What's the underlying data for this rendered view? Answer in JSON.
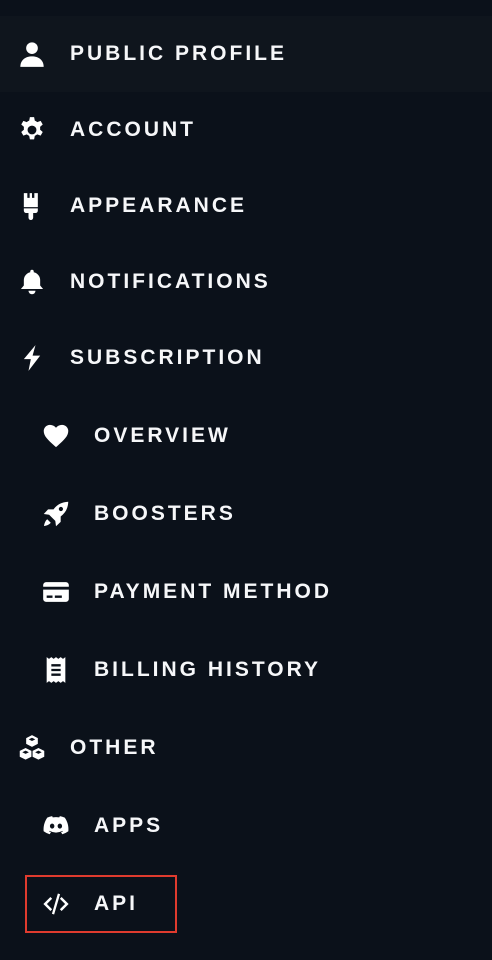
{
  "sidebar": {
    "items": [
      {
        "label": "PUBLIC PROFILE",
        "icon": "user-icon"
      },
      {
        "label": "ACCOUNT",
        "icon": "gear-icon"
      },
      {
        "label": "APPEARANCE",
        "icon": "paintbrush-icon"
      },
      {
        "label": "NOTIFICATIONS",
        "icon": "bell-icon"
      },
      {
        "label": "SUBSCRIPTION",
        "icon": "bolt-icon"
      },
      {
        "label": "OVERVIEW",
        "icon": "heart-icon"
      },
      {
        "label": "BOOSTERS",
        "icon": "rocket-icon"
      },
      {
        "label": "PAYMENT METHOD",
        "icon": "credit-card-icon"
      },
      {
        "label": "BILLING HISTORY",
        "icon": "receipt-icon"
      },
      {
        "label": "OTHER",
        "icon": "cubes-icon"
      },
      {
        "label": "APPS",
        "icon": "discord-icon"
      },
      {
        "label": "API",
        "icon": "code-icon"
      }
    ]
  },
  "colors": {
    "background": "#0b111a",
    "active_background": "#0f151d",
    "text": "#f6f7f9",
    "highlight": "#e03b2e"
  }
}
